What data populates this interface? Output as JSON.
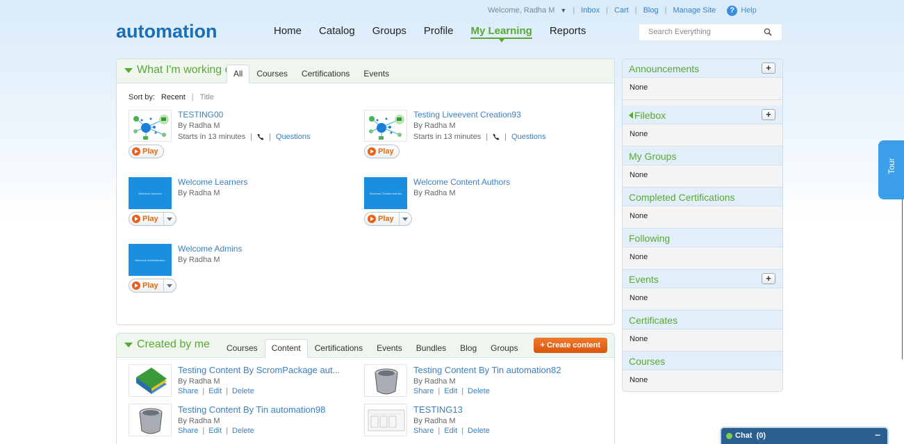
{
  "utility": {
    "welcome": "Welcome, Radha M",
    "links": [
      "Inbox",
      "Cart",
      "Blog",
      "Manage Site"
    ],
    "help": "Help"
  },
  "logo": "automation",
  "nav": [
    "Home",
    "Catalog",
    "Groups",
    "Profile",
    "My Learning",
    "Reports"
  ],
  "nav_active": "My Learning",
  "search": {
    "placeholder": "Search Everything"
  },
  "working": {
    "title": "What I'm working on",
    "tabs": [
      "All",
      "Courses",
      "Certifications",
      "Events"
    ],
    "active_tab": "All",
    "sort_label": "Sort by:",
    "sort_recent": "Recent",
    "sort_title": "Title",
    "items": [
      {
        "title": "TESTING00",
        "by": "By Radha M",
        "starts": "Starts in 13 minutes",
        "questions": "Questions",
        "play": "Play"
      },
      {
        "title": "Testing Liveevent Creation93",
        "by": "By Radha M",
        "starts": "Starts in 13 minutes",
        "questions": "Questions",
        "play": "Play"
      },
      {
        "title": "Welcome Learners",
        "by": "By Radha M",
        "play": "Play",
        "thumb_text": "Welcome Learners"
      },
      {
        "title": "Welcome Content Authors",
        "by": "By Radha M",
        "play": "Play",
        "thumb_text": "Welcome Content Authors"
      },
      {
        "title": "Welcome Admins",
        "by": "By Radha M",
        "play": "Play",
        "thumb_text": "Welcome Administrators"
      }
    ]
  },
  "created": {
    "title": "Created by me",
    "tabs": [
      "Courses",
      "Content",
      "Certifications",
      "Events",
      "Bundles",
      "Blog",
      "Groups"
    ],
    "active_tab": "Content",
    "create_btn": "+ Create content",
    "items": [
      {
        "title": "Testing Content By ScromPackage aut...",
        "by": "By Radha M",
        "share": "Share",
        "edit": "Edit",
        "delete": "Delete"
      },
      {
        "title": "Testing Content By Tin automation82",
        "by": "By Radha M",
        "share": "Share",
        "edit": "Edit",
        "delete": "Delete"
      },
      {
        "title": "Testing Content By Tin automation98",
        "by": "By Radha M",
        "share": "Share",
        "edit": "Edit",
        "delete": "Delete"
      },
      {
        "title": "TESTING13",
        "by": "By Radha M",
        "share": "Share",
        "edit": "Edit",
        "delete": "Delete"
      }
    ]
  },
  "sidebar": [
    {
      "title": "Announcements",
      "body": "None",
      "plus": true
    },
    {
      "title": "Filebox",
      "body": "None",
      "plus": true,
      "collapsed": true
    },
    {
      "title": "My Groups",
      "body": "None"
    },
    {
      "title": "Completed Certifications",
      "body": "None"
    },
    {
      "title": "Following",
      "body": "None"
    },
    {
      "title": "Events",
      "body": "None",
      "plus": true
    },
    {
      "title": "Certificates",
      "body": "None"
    },
    {
      "title": "Courses",
      "body": "None"
    }
  ],
  "tour": "Tour",
  "chat": {
    "label": "Chat",
    "count": "(0)",
    "minimize": "–"
  },
  "colors": {
    "accent_green": "#5aa832",
    "link_blue": "#3a7fc1",
    "brand_blue": "#1a6eb5",
    "orange": "#e2680f"
  }
}
